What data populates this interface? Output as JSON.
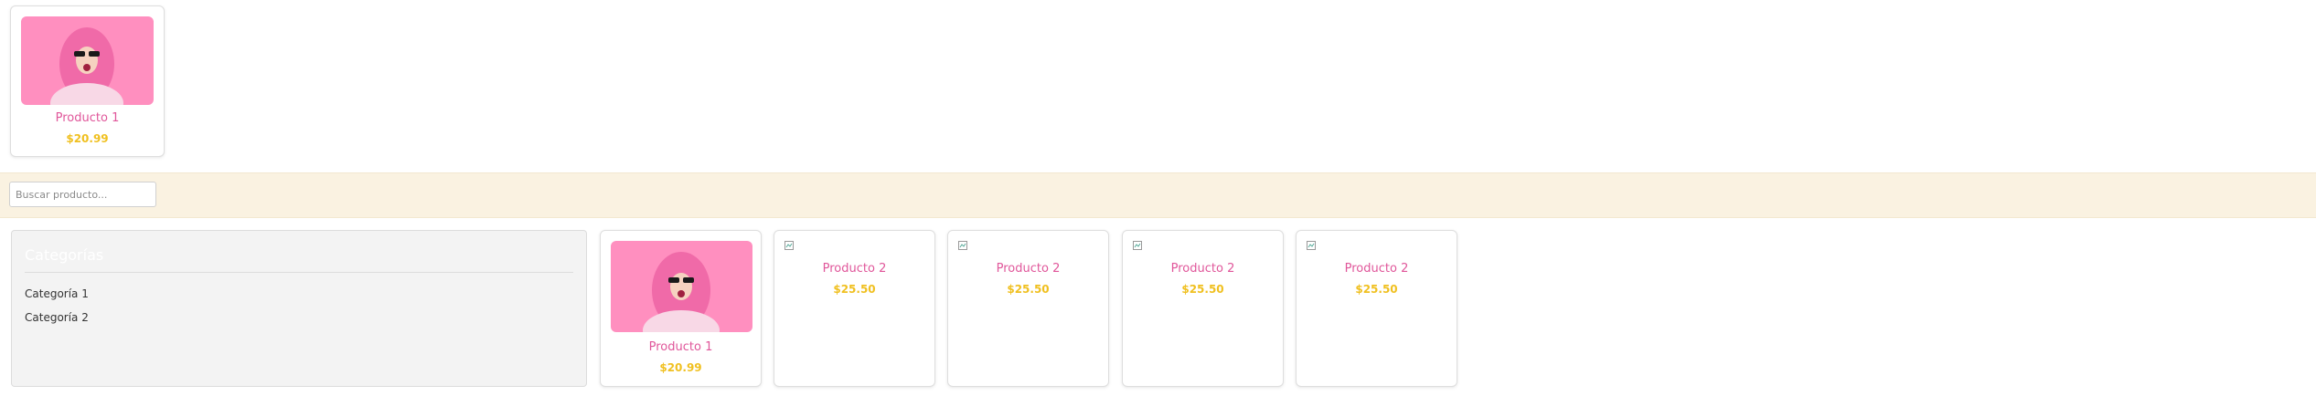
{
  "top_product": {
    "name": "Producto 1",
    "price": "$20.99"
  },
  "search": {
    "placeholder": "Buscar producto..."
  },
  "sidebar": {
    "title": "Categorías",
    "categories": [
      "Categoría 1",
      "Categoría 2"
    ]
  },
  "products": [
    {
      "name": "Producto 1",
      "price": "$20.99",
      "image": "photo"
    },
    {
      "name": "Producto 2",
      "price": "$25.50",
      "image": "broken"
    },
    {
      "name": "Producto 2",
      "price": "$25.50",
      "image": "broken"
    },
    {
      "name": "Producto 2",
      "price": "$25.50",
      "image": "broken"
    },
    {
      "name": "Producto 2",
      "price": "$25.50",
      "image": "broken"
    }
  ],
  "colors": {
    "accent_pink": "#e0569a",
    "price_yellow": "#f0c020",
    "search_band": "#faf2e1"
  }
}
